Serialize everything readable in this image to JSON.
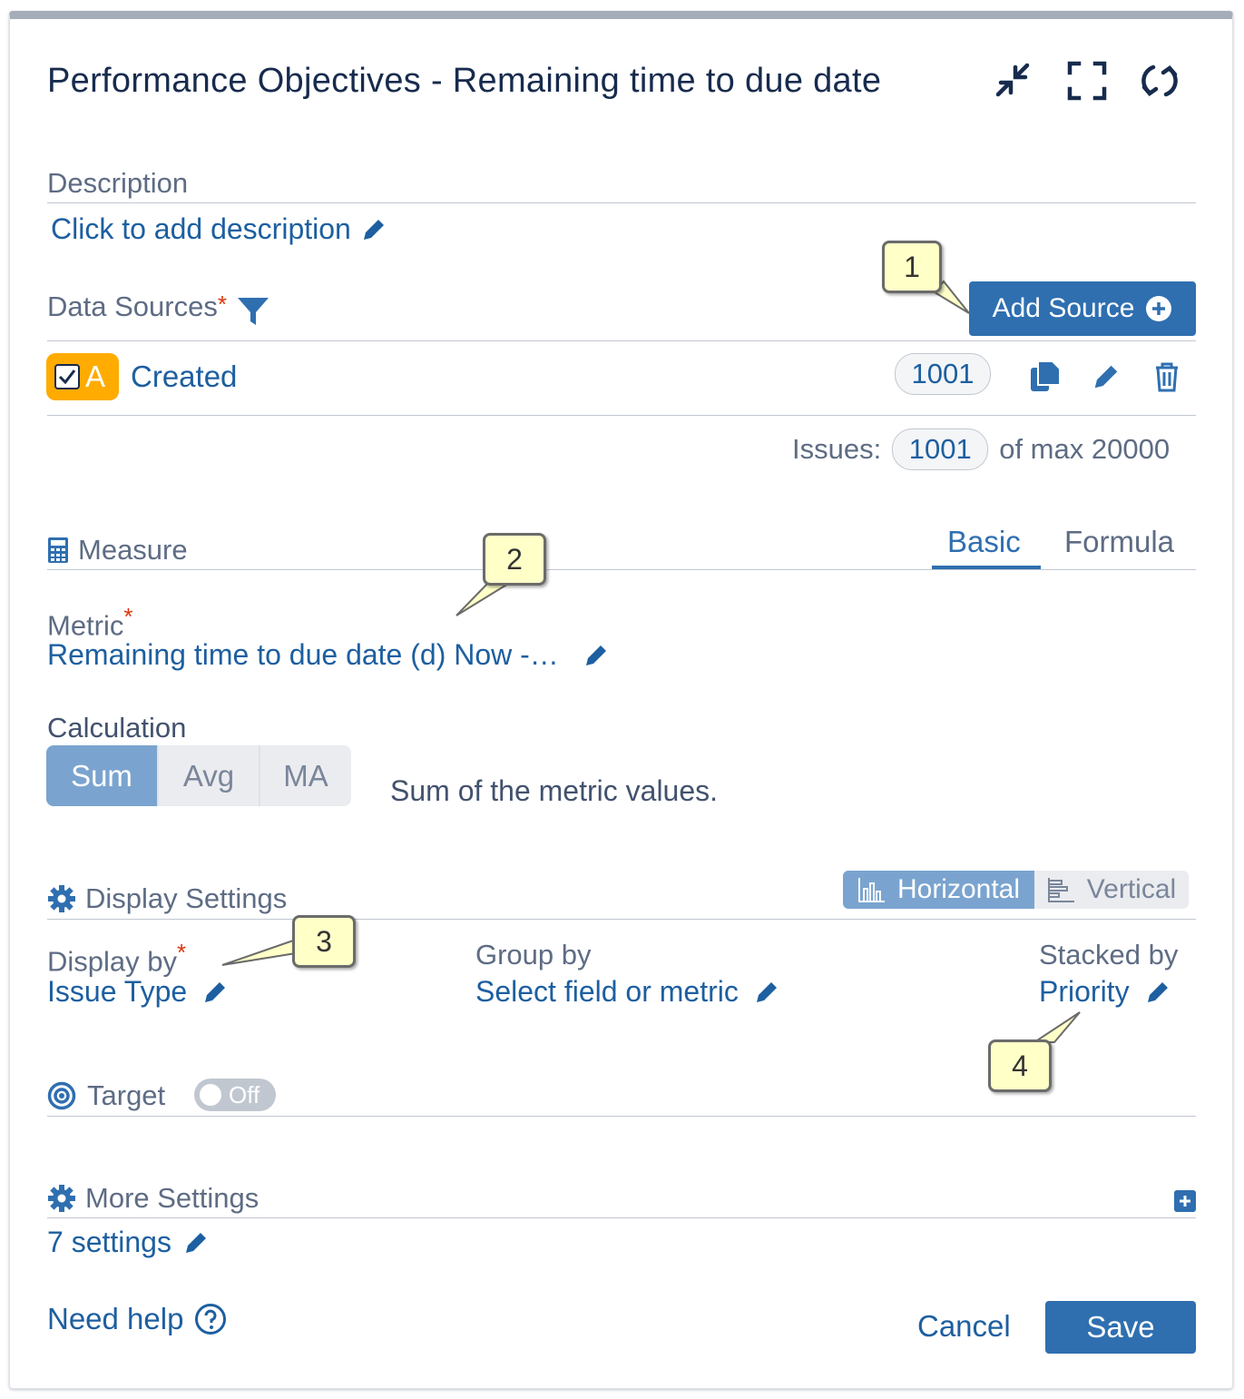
{
  "header": {
    "title": "Performance Objectives - Remaining time to due date",
    "icons": [
      "minimize-icon",
      "fullscreen-icon",
      "refresh-icon"
    ]
  },
  "description": {
    "label": "Description",
    "placeholder": "Click to add description"
  },
  "data_sources": {
    "label": "Data Sources",
    "required_mark": "*",
    "add_button": "Add Source",
    "source": {
      "letter": "A",
      "name": "Created",
      "count": "1001"
    },
    "issues_label": "Issues:",
    "issues_count": "1001",
    "issues_max": "of max 20000"
  },
  "measure": {
    "label": "Measure",
    "tabs": [
      "Basic",
      "Formula"
    ],
    "active_tab": "Basic",
    "metric_label": "Metric",
    "metric_value": "Remaining time to due date (d) Now -…",
    "calculation_label": "Calculation",
    "calculation_options": [
      "Sum",
      "Avg",
      "MA"
    ],
    "calculation_selected": "Sum",
    "calculation_desc": "Sum of the metric values."
  },
  "display_settings": {
    "label": "Display Settings",
    "orientation_options": [
      "Horizontal",
      "Vertical"
    ],
    "orientation_selected": "Horizontal",
    "display_by_label": "Display by",
    "display_by_value": "Issue Type",
    "group_by_label": "Group by",
    "group_by_value": "Select field or metric",
    "stacked_by_label": "Stacked by",
    "stacked_by_value": "Priority"
  },
  "target": {
    "label": "Target",
    "toggle": "Off"
  },
  "more_settings": {
    "label": "More Settings",
    "value": "7 settings"
  },
  "footer": {
    "help": "Need help",
    "cancel": "Cancel",
    "save": "Save"
  },
  "callouts": [
    "1",
    "2",
    "3",
    "4"
  ],
  "colors": {
    "primary": "#2f6fb0",
    "link": "#1d5fa0",
    "source_badge": "#ffab00",
    "callout_bg": "#ffffc8",
    "required": "#de350b"
  }
}
